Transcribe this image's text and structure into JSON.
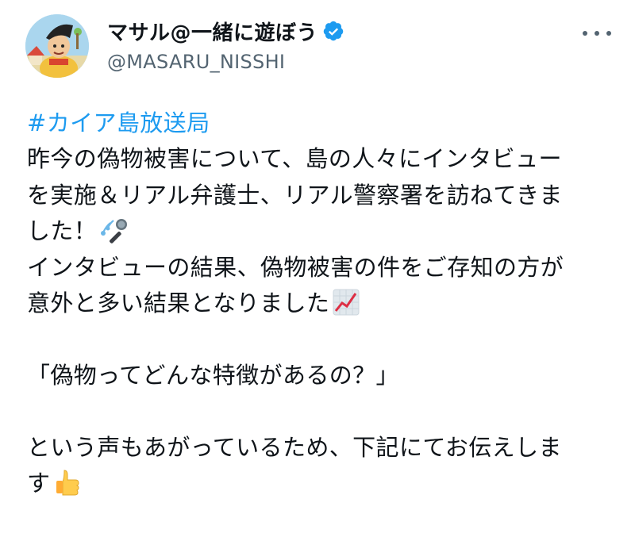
{
  "author": {
    "display_name": "マサル@一緒に遊ぼう",
    "handle": "@MASARU_NISSHI",
    "verified_icon": "verified-badge-icon",
    "more_icon": "more-options-icon"
  },
  "tweet": {
    "hashtag": "#カイア島放送局",
    "line1": "昨今の偽物被害について、島の人々にインタビュー",
    "line2": "を実施＆リアル弁護士、リアル警察署を訪ねてきま",
    "line3": "した！",
    "line3_emoji": "microphone-emoji",
    "line4": "インタビューの結果、偽物被害の件をご存知の方が",
    "line5": "意外と多い結果となりました",
    "line5_emoji": "chart-increasing-emoji",
    "line6": "「偽物ってどんな特徴があるの？」",
    "line7": "という声もあがっているため、下記にてお伝えしま",
    "line8": "す",
    "line8_emoji": "thumbs-up-emoji"
  },
  "colors": {
    "hashtag": "#1d9bf0",
    "verified": "#1d9bf0",
    "text": "#0f1419",
    "muted": "#536471"
  }
}
